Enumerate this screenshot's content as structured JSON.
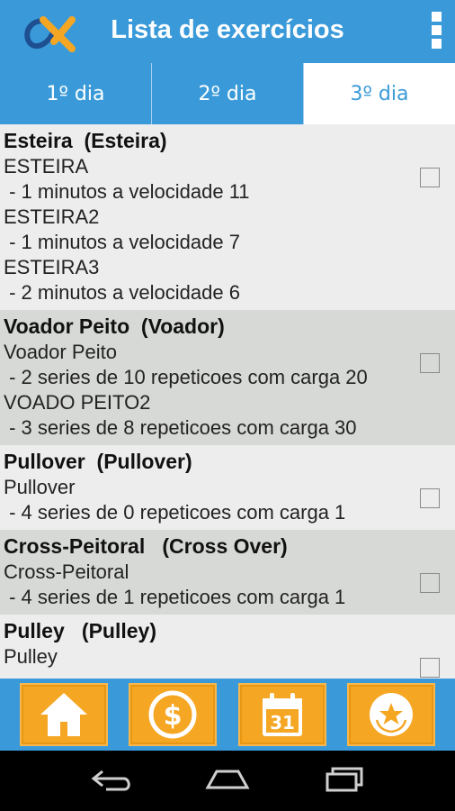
{
  "app": {
    "title": "Lista de exercícios",
    "logo_icon": "alpha-x-logo-icon"
  },
  "tabs": [
    {
      "label": "1º dia",
      "active": false
    },
    {
      "label": "2º dia",
      "active": false
    },
    {
      "label": "3º dia",
      "active": true
    }
  ],
  "exercises": [
    {
      "header": "Esteira  (Esteira)",
      "lines": [
        "ESTEIRA",
        " - 1 minutos a velocidade 11",
        "ESTEIRA2",
        " - 1 minutos a velocidade 7",
        "ESTEIRA3",
        " - 2 minutos a velocidade 6"
      ],
      "checked": false
    },
    {
      "header": "Voador Peito  (Voador)",
      "lines": [
        "Voador Peito",
        " - 2 series de 10 repeticoes com carga 20",
        "VOADO PEITO2",
        " - 3 series de 8 repeticoes com carga 30"
      ],
      "checked": false
    },
    {
      "header": "Pullover  (Pullover)",
      "lines": [
        "Pullover",
        " - 4 series de 0 repeticoes com carga 1"
      ],
      "checked": false
    },
    {
      "header": "Cross-Peitoral   (Cross Over)",
      "lines": [
        "Cross-Peitoral",
        " - 4 series de 1 repeticoes com carga 1"
      ],
      "checked": false
    },
    {
      "header": "Pulley   (Pulley)",
      "lines": [
        "Pulley"
      ],
      "checked": false
    }
  ],
  "bottom_buttons": [
    {
      "icon": "home-icon"
    },
    {
      "icon": "dollar-icon"
    },
    {
      "icon": "calendar-icon",
      "calendar_day": "31"
    },
    {
      "icon": "star-badge-icon"
    }
  ],
  "navbar": {
    "back": "back-icon",
    "home": "home-nav-icon",
    "recents": "recents-icon"
  },
  "colors": {
    "primary": "#3a9ad9",
    "accent": "#f5a623",
    "row_alt": "#d7d9d6",
    "row": "#ededed"
  }
}
